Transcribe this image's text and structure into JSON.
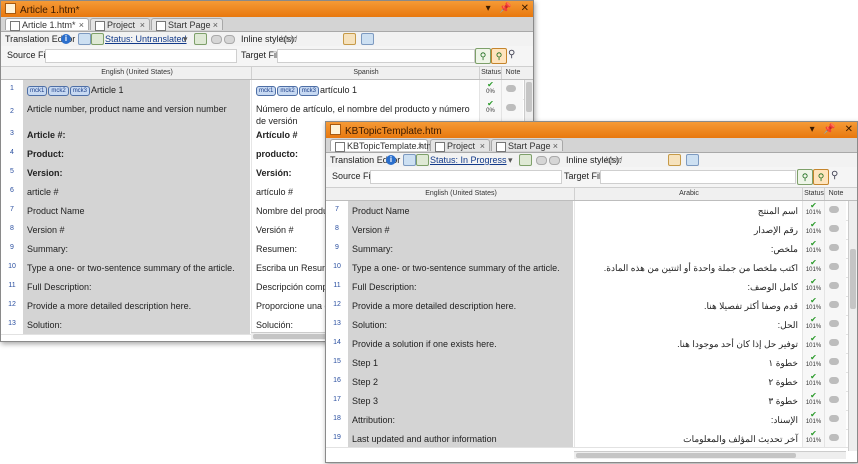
{
  "win1": {
    "title": "Article 1.htm*",
    "controls": [
      "▾",
      "📌",
      "✕"
    ],
    "tabs": [
      "Article 1.htm*",
      "Project",
      "Start Page"
    ],
    "toolbar": {
      "label": "Translation Editor",
      "status": "Status: Untranslated",
      "inline": "Inline style(s):",
      "inline_value": "html"
    },
    "filters": {
      "source": "Source Filter:",
      "target": "Target Filter:"
    },
    "headers": {
      "source": "English (United States)",
      "target": "Spanish",
      "status": "Status",
      "note": "Note"
    },
    "rows": [
      {
        "n": "1",
        "tags": [
          "mck1",
          "mck2",
          "mck3"
        ],
        "src": "Article 1",
        "tgt": "artículo 1",
        "bold": false,
        "pct": "0%",
        "done": true
      },
      {
        "n": "2",
        "tags": [],
        "src": "Article number, product name and version number",
        "tgt": "Número de artículo, el nombre del producto y número de versión",
        "bold": false,
        "pct": "0%",
        "done": true
      },
      {
        "n": "3",
        "tags": [],
        "src": "Article #:",
        "tgt": "Artículo #",
        "bold": true,
        "pct": "",
        "done": false
      },
      {
        "n": "4",
        "tags": [],
        "src": "Product:",
        "tgt": "producto:",
        "bold": true,
        "pct": "",
        "done": false
      },
      {
        "n": "5",
        "tags": [],
        "src": "Version:",
        "tgt": "Versión:",
        "bold": true,
        "pct": "",
        "done": false
      },
      {
        "n": "6",
        "tags": [],
        "src": "article #",
        "tgt": "artículo #",
        "bold": false,
        "pct": "",
        "done": false
      },
      {
        "n": "7",
        "tags": [],
        "src": "Product Name",
        "tgt": "Nombre del producto",
        "bold": false,
        "pct": "",
        "done": false
      },
      {
        "n": "8",
        "tags": [],
        "src": "Version #",
        "tgt": "Versión #",
        "bold": false,
        "pct": "",
        "done": false
      },
      {
        "n": "9",
        "tags": [],
        "src": "Summary:",
        "tgt": "Resumen:",
        "bold": false,
        "pct": "",
        "done": false
      },
      {
        "n": "10",
        "tags": [],
        "src": "Type a one- or two-sentence summary of the article.",
        "tgt": "Escriba un Resumen",
        "bold": false,
        "pct": "",
        "done": false
      },
      {
        "n": "11",
        "tags": [],
        "src": "Full Description:",
        "tgt": "Descripción completa",
        "bold": false,
        "pct": "",
        "done": false
      },
      {
        "n": "12",
        "tags": [],
        "src": "Provide a more detailed description here.",
        "tgt": "Proporcione una d",
        "bold": false,
        "pct": "",
        "done": false
      },
      {
        "n": "13",
        "tags": [],
        "src": "Solution:",
        "tgt": "Solución:",
        "bold": false,
        "pct": "",
        "done": false
      }
    ]
  },
  "win2": {
    "title": "KBTopicTemplate.htm",
    "controls": [
      "▾",
      "📌",
      "✕"
    ],
    "tabs": [
      "KBTopicTemplate.htm",
      "Project",
      "Start Page"
    ],
    "toolbar": {
      "label": "Translation Editor",
      "status": "Status: In Progress",
      "inline": "Inline style(s):",
      "inline_value": "html"
    },
    "filters": {
      "source": "Source Filter:",
      "target": "Target Filter:"
    },
    "headers": {
      "source": "English (United States)",
      "target": "Arabic",
      "status": "Status",
      "note": "Note"
    },
    "rows": [
      {
        "n": "7",
        "src": "Product Name",
        "tgt": "اسم المنتج",
        "pct": "101%"
      },
      {
        "n": "8",
        "src": "Version #",
        "tgt": "رقم الإصدار",
        "pct": "101%"
      },
      {
        "n": "9",
        "src": "Summary:",
        "tgt": "ملخص:",
        "pct": "101%"
      },
      {
        "n": "10",
        "src": "Type a one- or two-sentence summary of the article.",
        "tgt": "اكتب ملخصا من جملة واحدة أو اثنتين من هذه المادة.",
        "pct": "101%"
      },
      {
        "n": "11",
        "src": "Full Description:",
        "tgt": "كامل الوصف:",
        "pct": "101%"
      },
      {
        "n": "12",
        "src": "Provide a more detailed description here.",
        "tgt": "قدم وصفا أكثر تفصيلا هنا.",
        "pct": "101%"
      },
      {
        "n": "13",
        "src": "Solution:",
        "tgt": "الحل:",
        "pct": "101%"
      },
      {
        "n": "14",
        "src": "Provide a solution if one exists here.",
        "tgt": "توفير حل إذا كان أحد موجودا هنا.",
        "pct": "101%"
      },
      {
        "n": "15",
        "src": "Step 1",
        "tgt": "خطوة ١",
        "pct": "101%"
      },
      {
        "n": "16",
        "src": "Step 2",
        "tgt": "خطوة ٢",
        "pct": "101%"
      },
      {
        "n": "17",
        "src": "Step 3",
        "tgt": "خطوة ٣",
        "pct": "101%"
      },
      {
        "n": "18",
        "src": "Attribution:",
        "tgt": "الإسناد:",
        "pct": "101%"
      },
      {
        "n": "19",
        "src": "Last updated and author information",
        "tgt": "آخر تحديث المؤلف والمعلومات",
        "pct": "101%"
      }
    ]
  }
}
